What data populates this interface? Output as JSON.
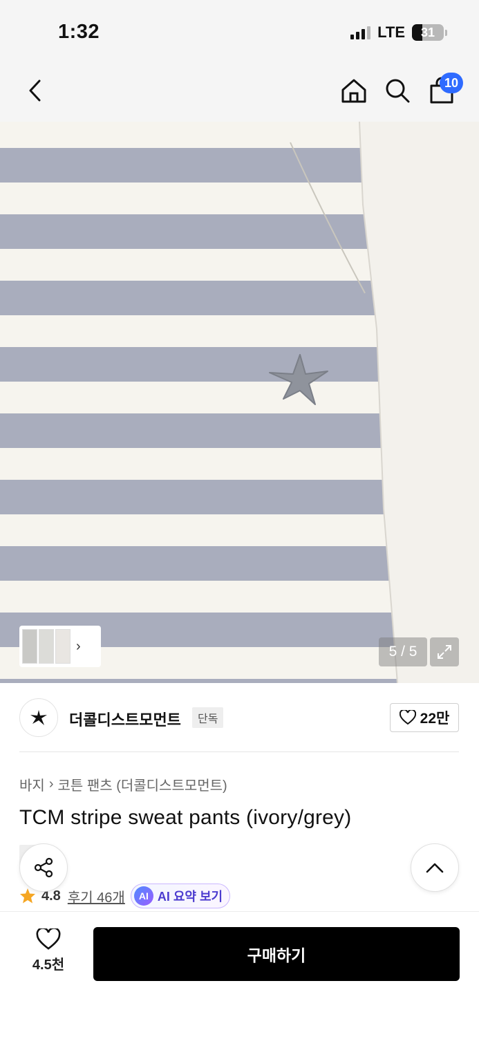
{
  "status_bar": {
    "time": "1:32",
    "network": "LTE",
    "battery": "31"
  },
  "nav": {
    "back_icon": "chevron-left-icon",
    "home_icon": "home-icon",
    "search_icon": "search-icon",
    "cart_icon": "shopping-bag-icon",
    "cart_count": "10",
    "badge_color": "#2f6bff"
  },
  "gallery": {
    "page": "5 / 5",
    "stripe_colors": [
      "#a9adbd",
      "#f6f4ee"
    ],
    "expand_icon": "expand-icon",
    "thumb_chevron": "›"
  },
  "brand": {
    "name": "더콜디스트모먼트",
    "tag": "단독",
    "like_count": "22만",
    "like_icon": "heart-outline-icon"
  },
  "product": {
    "breadcrumb": [
      "바지",
      "코튼 팬츠 (더콜디스트모먼트)"
    ],
    "breadcrumb_separator": "›",
    "title": "TCM stripe sweat pants (ivory/grey)",
    "tags": [
      "단독"
    ],
    "rating": "4.8",
    "review_label": "후기 46개",
    "ai_badge": "AI",
    "ai_label": "AI 요약 보기"
  },
  "fabs": {
    "share_icon": "share-icon",
    "scroll_top_icon": "chevron-up-icon"
  },
  "bottom_bar": {
    "wish_count": "4.5천",
    "buy_label": "구매하기",
    "buy_color": "#000000"
  }
}
